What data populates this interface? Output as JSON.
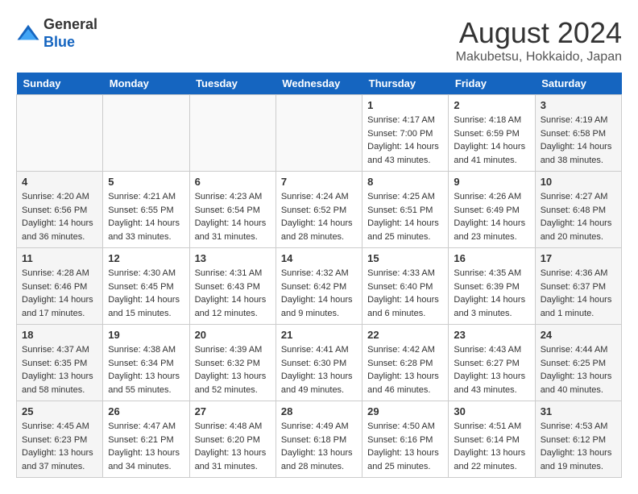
{
  "header": {
    "logo_line1": "General",
    "logo_line2": "Blue",
    "month_title": "August 2024",
    "location": "Makubetsu, Hokkaido, Japan"
  },
  "days_of_week": [
    "Sunday",
    "Monday",
    "Tuesday",
    "Wednesday",
    "Thursday",
    "Friday",
    "Saturday"
  ],
  "weeks": [
    [
      {
        "day": "",
        "detail": ""
      },
      {
        "day": "",
        "detail": ""
      },
      {
        "day": "",
        "detail": ""
      },
      {
        "day": "",
        "detail": ""
      },
      {
        "day": "1",
        "detail": "Sunrise: 4:17 AM\nSunset: 7:00 PM\nDaylight: 14 hours\nand 43 minutes."
      },
      {
        "day": "2",
        "detail": "Sunrise: 4:18 AM\nSunset: 6:59 PM\nDaylight: 14 hours\nand 41 minutes."
      },
      {
        "day": "3",
        "detail": "Sunrise: 4:19 AM\nSunset: 6:58 PM\nDaylight: 14 hours\nand 38 minutes."
      }
    ],
    [
      {
        "day": "4",
        "detail": "Sunrise: 4:20 AM\nSunset: 6:56 PM\nDaylight: 14 hours\nand 36 minutes."
      },
      {
        "day": "5",
        "detail": "Sunrise: 4:21 AM\nSunset: 6:55 PM\nDaylight: 14 hours\nand 33 minutes."
      },
      {
        "day": "6",
        "detail": "Sunrise: 4:23 AM\nSunset: 6:54 PM\nDaylight: 14 hours\nand 31 minutes."
      },
      {
        "day": "7",
        "detail": "Sunrise: 4:24 AM\nSunset: 6:52 PM\nDaylight: 14 hours\nand 28 minutes."
      },
      {
        "day": "8",
        "detail": "Sunrise: 4:25 AM\nSunset: 6:51 PM\nDaylight: 14 hours\nand 25 minutes."
      },
      {
        "day": "9",
        "detail": "Sunrise: 4:26 AM\nSunset: 6:49 PM\nDaylight: 14 hours\nand 23 minutes."
      },
      {
        "day": "10",
        "detail": "Sunrise: 4:27 AM\nSunset: 6:48 PM\nDaylight: 14 hours\nand 20 minutes."
      }
    ],
    [
      {
        "day": "11",
        "detail": "Sunrise: 4:28 AM\nSunset: 6:46 PM\nDaylight: 14 hours\nand 17 minutes."
      },
      {
        "day": "12",
        "detail": "Sunrise: 4:30 AM\nSunset: 6:45 PM\nDaylight: 14 hours\nand 15 minutes."
      },
      {
        "day": "13",
        "detail": "Sunrise: 4:31 AM\nSunset: 6:43 PM\nDaylight: 14 hours\nand 12 minutes."
      },
      {
        "day": "14",
        "detail": "Sunrise: 4:32 AM\nSunset: 6:42 PM\nDaylight: 14 hours\nand 9 minutes."
      },
      {
        "day": "15",
        "detail": "Sunrise: 4:33 AM\nSunset: 6:40 PM\nDaylight: 14 hours\nand 6 minutes."
      },
      {
        "day": "16",
        "detail": "Sunrise: 4:35 AM\nSunset: 6:39 PM\nDaylight: 14 hours\nand 3 minutes."
      },
      {
        "day": "17",
        "detail": "Sunrise: 4:36 AM\nSunset: 6:37 PM\nDaylight: 14 hours\nand 1 minute."
      }
    ],
    [
      {
        "day": "18",
        "detail": "Sunrise: 4:37 AM\nSunset: 6:35 PM\nDaylight: 13 hours\nand 58 minutes."
      },
      {
        "day": "19",
        "detail": "Sunrise: 4:38 AM\nSunset: 6:34 PM\nDaylight: 13 hours\nand 55 minutes."
      },
      {
        "day": "20",
        "detail": "Sunrise: 4:39 AM\nSunset: 6:32 PM\nDaylight: 13 hours\nand 52 minutes."
      },
      {
        "day": "21",
        "detail": "Sunrise: 4:41 AM\nSunset: 6:30 PM\nDaylight: 13 hours\nand 49 minutes."
      },
      {
        "day": "22",
        "detail": "Sunrise: 4:42 AM\nSunset: 6:28 PM\nDaylight: 13 hours\nand 46 minutes."
      },
      {
        "day": "23",
        "detail": "Sunrise: 4:43 AM\nSunset: 6:27 PM\nDaylight: 13 hours\nand 43 minutes."
      },
      {
        "day": "24",
        "detail": "Sunrise: 4:44 AM\nSunset: 6:25 PM\nDaylight: 13 hours\nand 40 minutes."
      }
    ],
    [
      {
        "day": "25",
        "detail": "Sunrise: 4:45 AM\nSunset: 6:23 PM\nDaylight: 13 hours\nand 37 minutes."
      },
      {
        "day": "26",
        "detail": "Sunrise: 4:47 AM\nSunset: 6:21 PM\nDaylight: 13 hours\nand 34 minutes."
      },
      {
        "day": "27",
        "detail": "Sunrise: 4:48 AM\nSunset: 6:20 PM\nDaylight: 13 hours\nand 31 minutes."
      },
      {
        "day": "28",
        "detail": "Sunrise: 4:49 AM\nSunset: 6:18 PM\nDaylight: 13 hours\nand 28 minutes."
      },
      {
        "day": "29",
        "detail": "Sunrise: 4:50 AM\nSunset: 6:16 PM\nDaylight: 13 hours\nand 25 minutes."
      },
      {
        "day": "30",
        "detail": "Sunrise: 4:51 AM\nSunset: 6:14 PM\nDaylight: 13 hours\nand 22 minutes."
      },
      {
        "day": "31",
        "detail": "Sunrise: 4:53 AM\nSunset: 6:12 PM\nDaylight: 13 hours\nand 19 minutes."
      }
    ]
  ]
}
